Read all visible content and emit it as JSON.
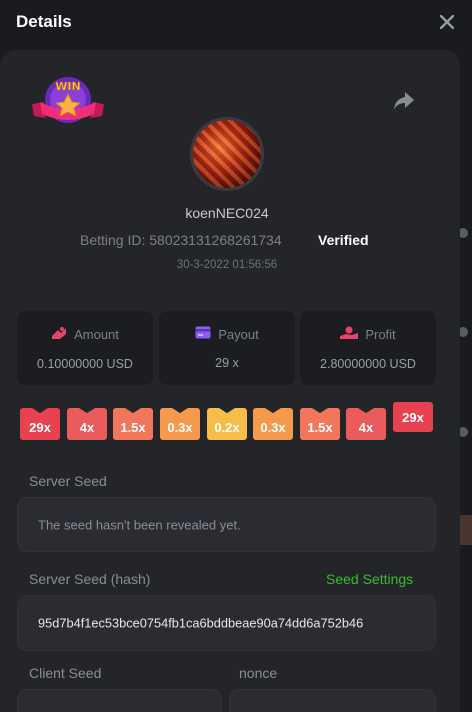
{
  "header": {
    "title": "Details",
    "close_icon": "close-icon"
  },
  "win_badge": {
    "text": "WIN",
    "icon": "win-badge-icon"
  },
  "share_icon": "share-icon",
  "user": {
    "name": "koenNEC024",
    "betting_id_label": "Betting ID: 58023131268261734",
    "verified": "Verified",
    "datetime": "30-3-2022 01:56:56"
  },
  "stats": [
    {
      "label": "Amount",
      "value": "0.10000000 USD",
      "icon": "amount-icon",
      "icon_color": "#e8436a"
    },
    {
      "label": "Payout",
      "value": "29 x",
      "icon": "payout-icon",
      "icon_color": "#8b5cf6"
    },
    {
      "label": "Profit",
      "value": "2.80000000 USD",
      "icon": "profit-icon",
      "icon_color": "#e8436a"
    }
  ],
  "multipliers": [
    {
      "label": "29x",
      "color": "#e8414f"
    },
    {
      "label": "4x",
      "color": "#ea5c5c"
    },
    {
      "label": "1.5x",
      "color": "#f2765c"
    },
    {
      "label": "0.3x",
      "color": "#f59a4c"
    },
    {
      "label": "0.2x",
      "color": "#f6bd49"
    },
    {
      "label": "0.3x",
      "color": "#f59a4c"
    },
    {
      "label": "1.5x",
      "color": "#f2765c"
    },
    {
      "label": "4x",
      "color": "#ea5c5c"
    },
    {
      "label": "29x",
      "color": "#e8414f"
    }
  ],
  "server_seed": {
    "label": "Server Seed",
    "value": "The seed hasn't been revealed yet."
  },
  "server_seed_hash": {
    "label": "Server Seed (hash)",
    "settings_link": "Seed Settings",
    "value": "95d7b4f1ec53bce0754fb1ca6bddbeae90a74dd6a752b46"
  },
  "client_seed": {
    "label": "Client Seed"
  },
  "nonce": {
    "label": "nonce"
  },
  "colors": {
    "background": "#1a1b1f",
    "panel": "#242529",
    "accent_green": "#3fb832"
  }
}
